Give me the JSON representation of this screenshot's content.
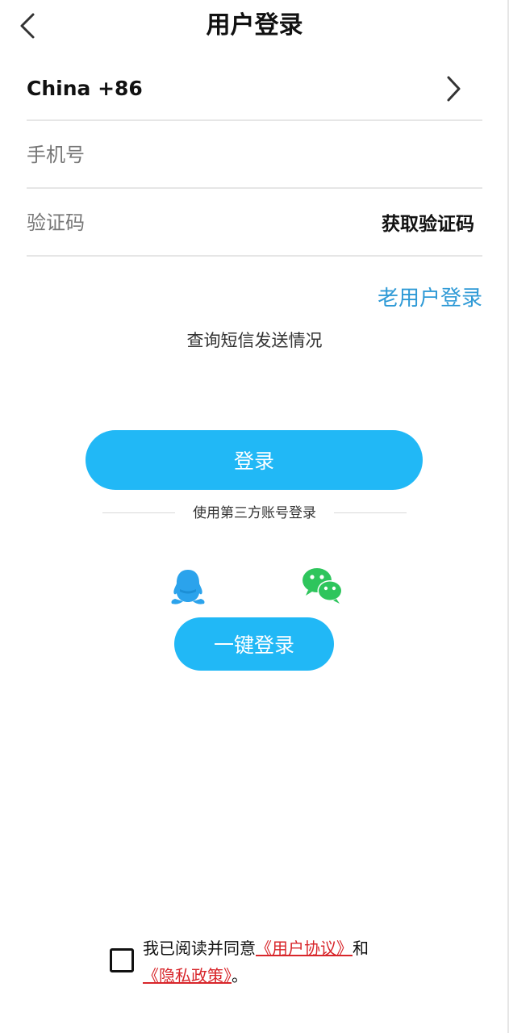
{
  "header": {
    "title": "用户登录",
    "back_icon": "chevron-left-icon"
  },
  "form": {
    "country": "China +86",
    "country_chevron_icon": "chevron-right-icon",
    "phone_placeholder": "手机号",
    "phone_value": "",
    "code_placeholder": "验证码",
    "code_value": "",
    "get_code_label": "获取验证码"
  },
  "links": {
    "old_user_login": "老用户登录",
    "sms_query": "查询短信发送情况"
  },
  "actions": {
    "login_label": "登录",
    "third_party_label": "使用第三方账号登录",
    "qq_icon": "qq-icon",
    "wechat_icon": "wechat-icon",
    "one_click_label": "一键登录"
  },
  "agreement": {
    "checked": false,
    "prefix": "我已阅读并同意",
    "user_agreement": "《用户协议》",
    "and": "和",
    "privacy_policy": "《隐私政策》",
    "suffix": "。"
  },
  "colors": {
    "primary_button": "#21b8f6",
    "link_blue": "#2f9ad6",
    "agreement_red": "#d8262b",
    "qq_blue": "#2ba3ec",
    "wechat_green": "#2ec55c"
  }
}
